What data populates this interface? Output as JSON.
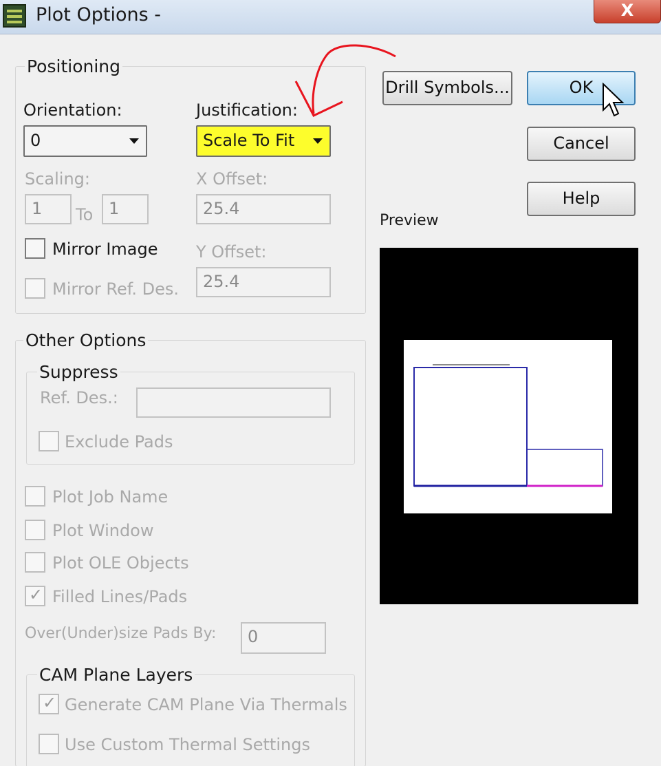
{
  "window": {
    "title": "Plot Options -",
    "close_label": "X"
  },
  "positioning": {
    "legend": "Positioning",
    "orientation_label": "Orientation:",
    "orientation_value": "0",
    "justification_label": "Justification:",
    "justification_value": "Scale To Fit",
    "scaling_label": "Scaling:",
    "scaling_from": "1",
    "scaling_to_label": "To",
    "scaling_to": "1",
    "x_offset_label": "X Offset:",
    "x_offset_value": "25.4",
    "y_offset_label": "Y Offset:",
    "y_offset_value": "25.4",
    "mirror_image_label": "Mirror Image",
    "mirror_refdes_label": "Mirror Ref. Des."
  },
  "buttons": {
    "drill_symbols": "Drill Symbols...",
    "ok": "OK",
    "cancel": "Cancel",
    "help": "Help"
  },
  "preview": {
    "label": "Preview"
  },
  "other_options": {
    "legend": "Other Options",
    "suppress_legend": "Suppress",
    "ref_des_label": "Ref. Des.:",
    "ref_des_value": "",
    "exclude_pads_label": "Exclude Pads",
    "plot_job_name_label": "Plot Job Name",
    "plot_window_label": "Plot Window",
    "plot_ole_label": "Plot OLE Objects",
    "filled_lines_label": "Filled Lines/Pads",
    "oversize_label": "Over(Under)size Pads By:",
    "oversize_value": "0"
  },
  "cam_plane": {
    "legend": "CAM Plane Layers",
    "generate_label": "Generate CAM Plane Via Thermals",
    "custom_thermal_label": "Use Custom Thermal Settings"
  },
  "colors": {
    "highlight": "#fdfd2c",
    "annotation": "#e8141e",
    "preview_outline": "#1f1fa0",
    "preview_magenta": "#d020c8"
  }
}
